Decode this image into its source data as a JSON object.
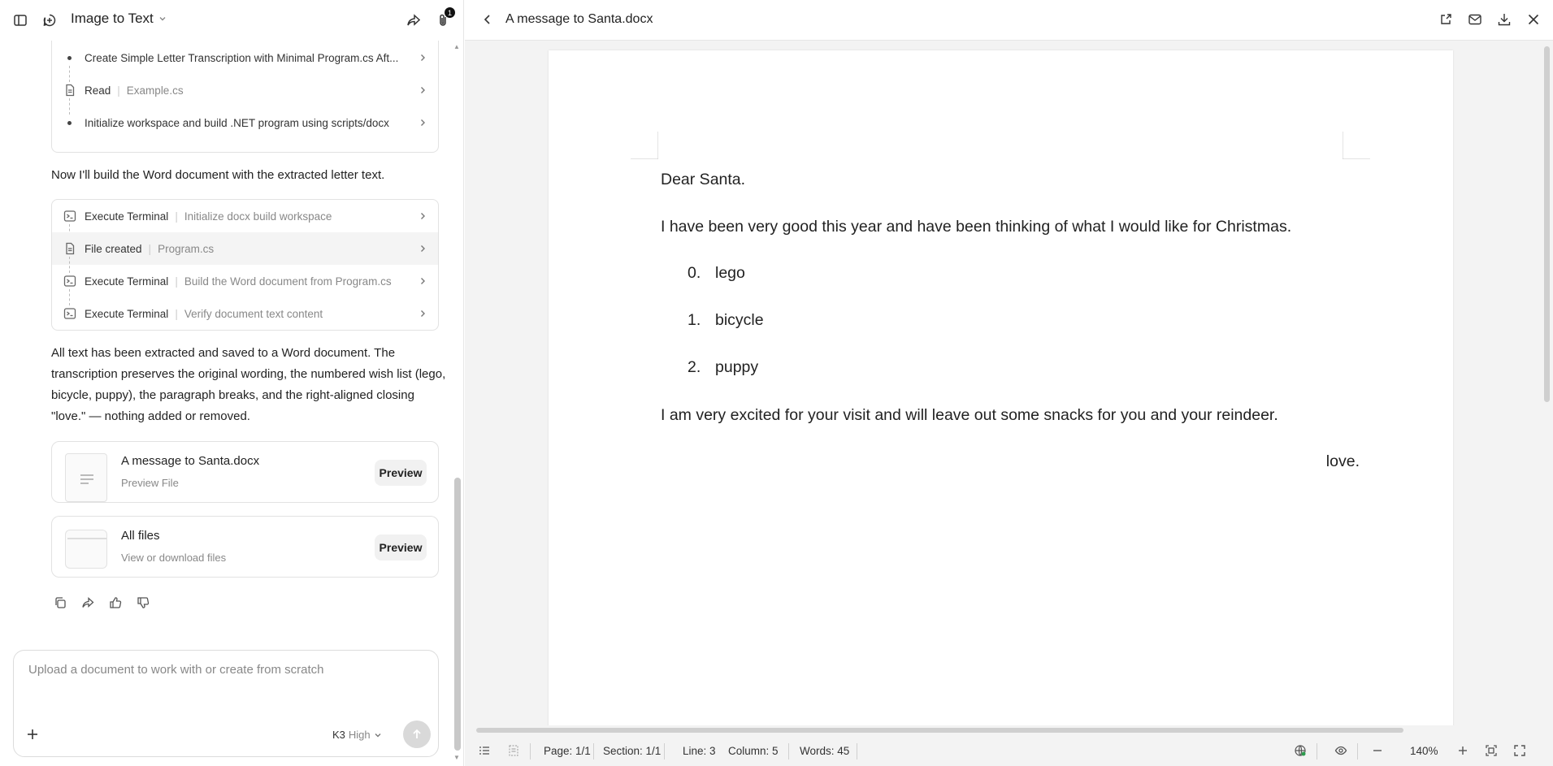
{
  "app": {
    "title": "Image to Text",
    "badge_count": "1"
  },
  "chat": {
    "group1_steps": [
      {
        "text": "Create Simple Letter Transcription with Minimal Program.cs Aft...",
        "kind": "bullet"
      },
      {
        "label": "Read",
        "detail": "Example.cs",
        "icon": "file-icon"
      },
      {
        "text": "Initialize workspace and build .NET program using scripts/docx",
        "kind": "bullet"
      }
    ],
    "message1": "Now I'll build the Word document with the extracted letter text.",
    "group2_steps": [
      {
        "label": "Execute Terminal",
        "detail": "Initialize docx build workspace",
        "icon": "terminal-icon"
      },
      {
        "label": "File created",
        "detail": "Program.cs",
        "icon": "file-icon"
      },
      {
        "label": "Execute Terminal",
        "detail": "Build the Word document from Program.cs",
        "icon": "terminal-icon"
      },
      {
        "label": "Execute Terminal",
        "detail": "Verify document text content",
        "icon": "terminal-icon"
      }
    ],
    "message2": "All text has been extracted and saved to a Word document. The transcription preserves the original wording, the numbered wish list (lego, bicycle, puppy), the paragraph breaks, and the right-aligned closing \"love.\" — nothing added or removed.",
    "file_card": {
      "name": "A message to Santa.docx",
      "sub": "Preview File",
      "button": "Preview"
    },
    "all_files_card": {
      "name": "All files",
      "sub": "View or download files",
      "button": "Preview"
    }
  },
  "composer": {
    "placeholder": "Upload a document to work with or create from scratch",
    "model": "K3",
    "level": "High"
  },
  "viewer": {
    "title": "A message to Santa.docx",
    "doc": {
      "greeting": "Dear Santa.",
      "intro": "I have been very good this year and have been thinking of what I would like for Christmas.",
      "items": [
        {
          "num": "0.",
          "text": "lego"
        },
        {
          "num": "1.",
          "text": "bicycle"
        },
        {
          "num": "2.",
          "text": "puppy"
        }
      ],
      "closing_para": "I am very excited for your visit and will leave out some snacks for you and your reindeer.",
      "signoff": "love."
    },
    "status": {
      "page": "Page: 1/1",
      "section": "Section: 1/1",
      "line": "Line: 3",
      "column": "Column: 5",
      "words": "Words: 45",
      "zoom": "140%"
    }
  },
  "colors": {
    "page_bg": "#f3f3f3",
    "panel_bg": "#ffffff",
    "border": "#e2e2e2",
    "send_disabled": "#d9d9d9"
  }
}
